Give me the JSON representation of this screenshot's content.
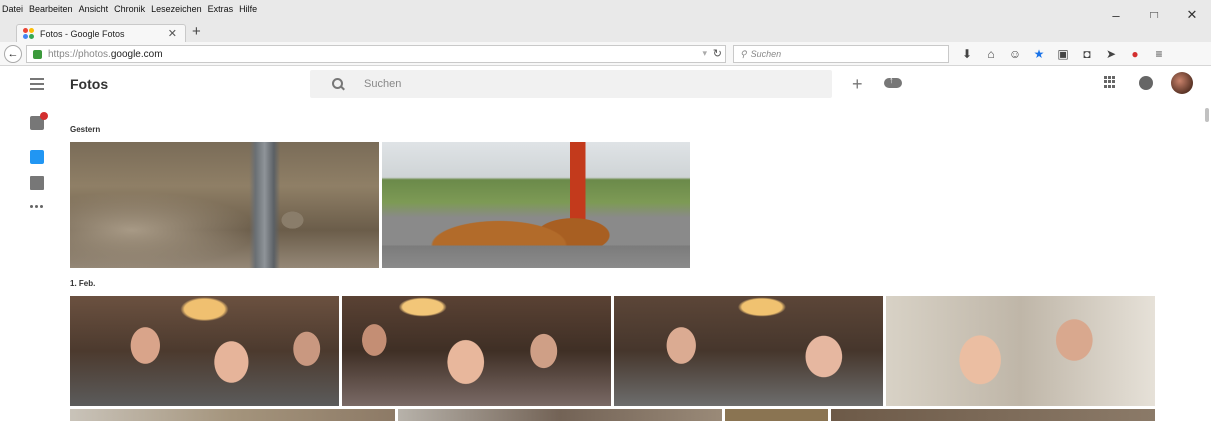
{
  "menubar": {
    "items": [
      "Datei",
      "Bearbeiten",
      "Ansicht",
      "Chronik",
      "Lesezeichen",
      "Extras",
      "Hilfe"
    ]
  },
  "window_controls": [
    "–",
    "□",
    "✕"
  ],
  "tab": {
    "title": "Fotos - Google Fotos",
    "close": "✕",
    "new_tab": "+"
  },
  "navbar": {
    "url_prefix": "https://photos.",
    "url_host": "google.com",
    "search_placeholder": "Suchen",
    "toolbar_icons": [
      "download-icon",
      "home-icon",
      "chat-icon",
      "star-icon",
      "clipboard-icon",
      "pocket-icon",
      "send-icon",
      "adblock-icon",
      "menu-icon"
    ]
  },
  "app": {
    "title": "Fotos",
    "search_placeholder": "Suchen"
  },
  "sidebar": {
    "items": [
      "assistant",
      "photos",
      "albums",
      "more"
    ]
  },
  "sections": [
    {
      "date": "Gestern",
      "photos": [
        "trench-with-pipe",
        "excavator-with-dirt-piles"
      ]
    },
    {
      "date": "1. Feb.",
      "photos": [
        "restaurant-women-and-girl",
        "girl-laughing-with-women",
        "woman-and-elderly-woman",
        "girl-and-elderly-man"
      ]
    }
  ],
  "colors": {
    "accent": "#2196f3",
    "notification": "#d32f2f",
    "search_bg": "#f1f1f1"
  }
}
